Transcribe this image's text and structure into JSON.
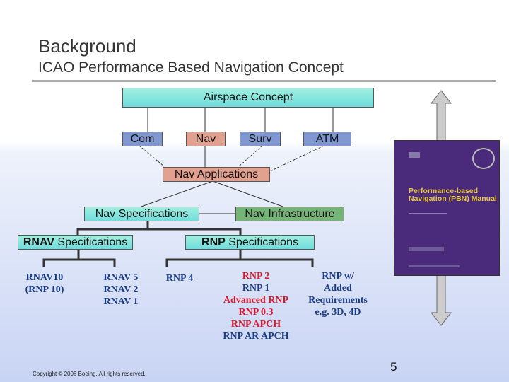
{
  "slide": {
    "title": "Background",
    "subtitle": "ICAO Performance Based Navigation Concept",
    "page_number": "5",
    "copyright": "Copyright © 2006 Boeing. All rights reserved."
  },
  "diagram": {
    "airspace": "Airspace Concept",
    "com": "Com",
    "nav": "Nav",
    "surv": "Surv",
    "atm": "ATM",
    "nav_applications": "Nav Applications",
    "nav_specifications": "Nav Specifications",
    "nav_infrastructure": "Nav Infrastructure",
    "rnav_spec": {
      "bold": "RNAV",
      "rest": " Specifications"
    },
    "rnp_spec": {
      "bold": "RNP",
      "rest": " Specifications"
    },
    "rnav10": [
      "RNAV10",
      "(RNP 10)"
    ],
    "rnav_group": [
      "RNAV 5",
      "RNAV 2",
      "RNAV 1"
    ],
    "rnp4": "RNP 4",
    "rnp_group": [
      {
        "text": "RNP 2",
        "red": true
      },
      {
        "text": "RNP 1",
        "red": false
      },
      {
        "text": "Advanced RNP",
        "red": true
      },
      {
        "text": "RNP 0.3",
        "red": true
      },
      {
        "text": "RNP APCH",
        "red": true
      },
      {
        "text": "RNP AR APCH",
        "red": false
      }
    ],
    "rnp_added": [
      "RNP w/",
      "Added",
      "Requirements",
      "e.g. 3D, 4D"
    ]
  },
  "manual_cover": {
    "title": "Performance-based Navigation (PBN) Manual"
  },
  "colors": {
    "cyan": "#70dcdc",
    "blue": "#8197d2",
    "salmon": "#e2a08e",
    "green": "#75b477",
    "red_text": "#d8182a",
    "blue_text": "#1a3c8c",
    "cover": "#4a2a7a"
  }
}
